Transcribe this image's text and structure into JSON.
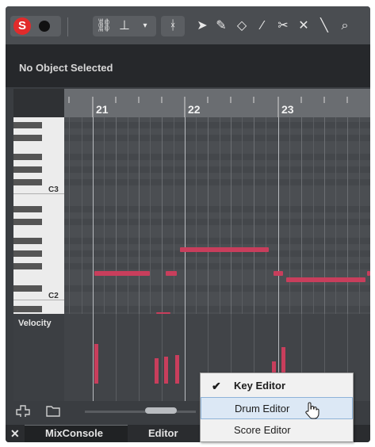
{
  "toolbar": {
    "solo_label": "S",
    "tools": [
      "link-icon",
      "snap-icon",
      "dropdown-icon",
      "quantize-icon",
      "pointer-icon",
      "pencil-icon",
      "eraser-icon",
      "brush-icon",
      "scissors-icon",
      "mute-icon",
      "line-icon",
      "zoom-icon"
    ]
  },
  "info_line": {
    "text": "No Object Selected"
  },
  "ruler": {
    "bars": [
      "21",
      "22",
      "23"
    ]
  },
  "keyboard": {
    "labels": [
      "C3",
      "C2"
    ]
  },
  "velocity": {
    "label": "Velocity"
  },
  "tabs": {
    "close": "✕",
    "mixconsole": "MixConsole",
    "editor": "Editor"
  },
  "menu": {
    "items": [
      {
        "label": "Key Editor",
        "checked": true
      },
      {
        "label": "Drum Editor",
        "checked": false
      },
      {
        "label": "Score Editor",
        "checked": false
      }
    ],
    "check_glyph": "✔"
  },
  "colors": {
    "note": "#c83e5c",
    "solo": "#e22b2b",
    "highlight": "#dce8f5"
  }
}
